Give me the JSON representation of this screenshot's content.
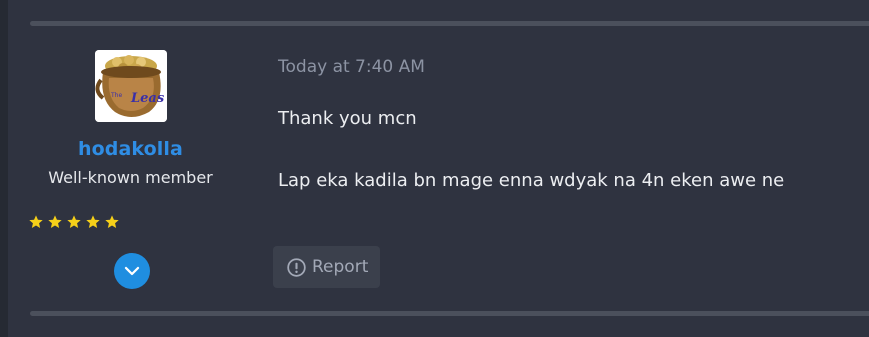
{
  "post": {
    "author": {
      "username": "hodakolla",
      "title": "Well-known member",
      "rating_stars": 5,
      "avatar_text": "Leas"
    },
    "timestamp": "Today at 7:40 AM",
    "message": {
      "lines": [
        "Thank you mcn",
        "Lap eka kadila bn mage enna wdyak na 4n eken awe ne"
      ]
    },
    "actions": {
      "report_label": "Report"
    }
  },
  "colors": {
    "background": "#2f3340",
    "username": "#2f8de4",
    "expand_button": "#1f8ee0",
    "star": "#f6d019",
    "timestamp": "#8c93a3"
  },
  "icons": {
    "expand": "chevron-down-icon",
    "report": "report-icon",
    "star": "star-icon"
  }
}
